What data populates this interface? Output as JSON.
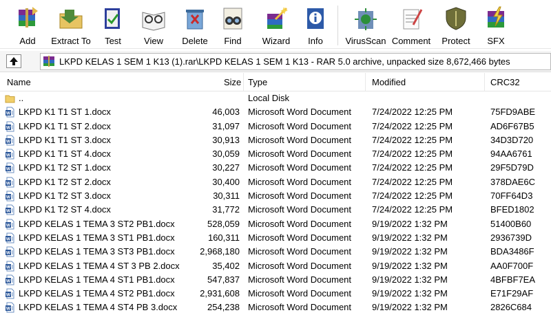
{
  "toolbar": {
    "buttons": [
      {
        "id": "add",
        "label": "Add",
        "icon": "add-archive-icon"
      },
      {
        "id": "extract",
        "label": "Extract To",
        "icon": "extract-folder-icon"
      },
      {
        "id": "test",
        "label": "Test",
        "icon": "test-book-icon"
      },
      {
        "id": "view",
        "label": "View",
        "icon": "glasses-book-icon"
      },
      {
        "id": "delete",
        "label": "Delete",
        "icon": "delete-bin-icon"
      },
      {
        "id": "find",
        "label": "Find",
        "icon": "binoculars-icon"
      },
      {
        "id": "wizard",
        "label": "Wizard",
        "icon": "wizard-wand-icon"
      },
      {
        "id": "info",
        "label": "Info",
        "icon": "info-book-icon"
      },
      {
        "id": "virusscan",
        "label": "VirusScan",
        "icon": "virus-scan-icon"
      },
      {
        "id": "comment",
        "label": "Comment",
        "icon": "comment-notepad-icon"
      },
      {
        "id": "protect",
        "label": "Protect",
        "icon": "shield-icon"
      },
      {
        "id": "sfx",
        "label": "SFX",
        "icon": "sfx-archive-icon"
      }
    ]
  },
  "address": {
    "path": "LKPD KELAS 1 SEM 1 K13 (1).rar\\LKPD KELAS 1 SEM 1 K13 - RAR 5.0 archive, unpacked size 8,672,466 bytes"
  },
  "columns": {
    "name": "Name",
    "size": "Size",
    "type": "Type",
    "modified": "Modified",
    "crc": "CRC32"
  },
  "rows": [
    {
      "name": "..",
      "size": "",
      "type": "Local Disk",
      "modified": "",
      "crc": "",
      "kind": "folder"
    },
    {
      "name": "LKPD K1 T1 ST 1.docx",
      "size": "46,003",
      "type": "Microsoft Word Document",
      "modified": "7/24/2022 12:25 PM",
      "crc": "75FD9ABE",
      "kind": "docx"
    },
    {
      "name": "LKPD K1 T1 ST 2.docx",
      "size": "31,097",
      "type": "Microsoft Word Document",
      "modified": "7/24/2022 12:25 PM",
      "crc": "AD6F67B5",
      "kind": "docx"
    },
    {
      "name": "LKPD K1 T1 ST 3.docx",
      "size": "30,913",
      "type": "Microsoft Word Document",
      "modified": "7/24/2022 12:25 PM",
      "crc": "34D3D720",
      "kind": "docx"
    },
    {
      "name": "LKPD K1 T1 ST 4.docx",
      "size": "30,059",
      "type": "Microsoft Word Document",
      "modified": "7/24/2022 12:25 PM",
      "crc": "94AA6761",
      "kind": "docx"
    },
    {
      "name": "LKPD K1 T2 ST 1.docx",
      "size": "30,227",
      "type": "Microsoft Word Document",
      "modified": "7/24/2022 12:25 PM",
      "crc": "29F5D79D",
      "kind": "docx"
    },
    {
      "name": "LKPD K1 T2 ST 2.docx",
      "size": "30,400",
      "type": "Microsoft Word Document",
      "modified": "7/24/2022 12:25 PM",
      "crc": "378DAE6C",
      "kind": "docx"
    },
    {
      "name": "LKPD K1 T2 ST 3.docx",
      "size": "30,311",
      "type": "Microsoft Word Document",
      "modified": "7/24/2022 12:25 PM",
      "crc": "70FF64D3",
      "kind": "docx"
    },
    {
      "name": "LKPD K1 T2 ST 4.docx",
      "size": "31,772",
      "type": "Microsoft Word Document",
      "modified": "7/24/2022 12:25 PM",
      "crc": "BFED1802",
      "kind": "docx"
    },
    {
      "name": "LKPD KELAS 1 TEMA  3 ST2 PB1.docx",
      "size": "528,059",
      "type": "Microsoft Word Document",
      "modified": "9/19/2022 1:32 PM",
      "crc": "51400B60",
      "kind": "docx"
    },
    {
      "name": "LKPD KELAS 1 TEMA 3 ST1 PB1.docx",
      "size": "160,311",
      "type": "Microsoft Word Document",
      "modified": "9/19/2022 1:32 PM",
      "crc": "2936739D",
      "kind": "docx"
    },
    {
      "name": "LKPD KELAS 1 TEMA 3 ST3 PB1.docx",
      "size": "2,968,180",
      "type": "Microsoft Word Document",
      "modified": "9/19/2022 1:32 PM",
      "crc": "BDA3486F",
      "kind": "docx"
    },
    {
      "name": "LKPD KELAS 1 TEMA 4 ST 3 PB 2.docx",
      "size": "35,402",
      "type": "Microsoft Word Document",
      "modified": "9/19/2022 1:32 PM",
      "crc": "AA0F700F",
      "kind": "docx"
    },
    {
      "name": "LKPD KELAS 1 TEMA 4 ST1 PB1.docx",
      "size": "547,837",
      "type": "Microsoft Word Document",
      "modified": "9/19/2022 1:32 PM",
      "crc": "4BFBF7EA",
      "kind": "docx"
    },
    {
      "name": "LKPD KELAS 1 TEMA 4 ST2 PB1.docx",
      "size": "2,931,608",
      "type": "Microsoft Word Document",
      "modified": "9/19/2022 1:32 PM",
      "crc": "E71F29AF",
      "kind": "docx"
    },
    {
      "name": "LKPD KELAS 1 TEMA 4 ST4 PB 3.docx",
      "size": "254,238",
      "type": "Microsoft Word Document",
      "modified": "9/19/2022 1:32 PM",
      "crc": "2826C684",
      "kind": "docx"
    }
  ]
}
